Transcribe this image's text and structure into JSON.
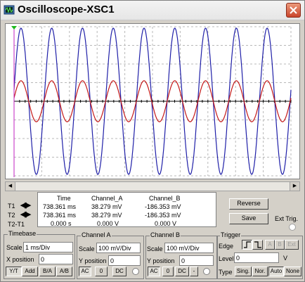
{
  "window": {
    "title": "Oscilloscope-XSC1"
  },
  "chart_data": {
    "type": "line",
    "title": "",
    "xlabel": "",
    "ylabel": "",
    "grid": true,
    "series": [
      {
        "color": "#1f1fa8",
        "description_role": "large amplitude sine",
        "amplitude": 1.0,
        "cycles": 9
      },
      {
        "color": "#c41818",
        "description_role": "small amplitude sine",
        "amplitude": 0.28,
        "cycles": 9
      }
    ],
    "colors": {
      "blue": "#1f1fa8",
      "red": "#c41818",
      "cursor": "#c020c0"
    }
  },
  "cursors": {
    "t1_label": "T1",
    "t2_label": "T2",
    "diff_label": "T2-T1",
    "arrows": "◀▶"
  },
  "readout": {
    "headers": {
      "time": "Time",
      "a": "Channel_A",
      "b": "Channel_B"
    },
    "rows": [
      {
        "time": "738.361 ms",
        "a": "38.279 mV",
        "b": "-186.353 mV"
      },
      {
        "time": "738.361 ms",
        "a": "38.279 mV",
        "b": "-186.353 mV"
      },
      {
        "time": "0.000 s",
        "a": "0.000 V",
        "b": "0.000 V"
      }
    ]
  },
  "buttons": {
    "reverse": "Reverse",
    "save": "Save",
    "ext_trig": "Ext Trig."
  },
  "timebase": {
    "label": "Timebase",
    "scale_label": "Scale",
    "scale_value": "1 ms/Div",
    "xpos_label": "X position",
    "xpos_value": "0",
    "modes": [
      "Y/T",
      "Add",
      "B/A",
      "A/B"
    ]
  },
  "channel_a": {
    "label": "Channel A",
    "scale_label": "Scale",
    "scale_value": "100 mV/Div",
    "ypos_label": "Y position",
    "ypos_value": "0",
    "coupling": [
      "AC",
      "0",
      "DC"
    ]
  },
  "channel_b": {
    "label": "Channel B",
    "scale_label": "Scale",
    "scale_value": "100 mV/Div",
    "ypos_label": "Y position",
    "ypos_value": "0",
    "coupling": [
      "AC",
      "0",
      "DC",
      "-"
    ]
  },
  "trigger": {
    "label": "Trigger",
    "edge_label": "Edge",
    "edge_sources": [
      "A",
      "B",
      "Ext"
    ],
    "level_label": "Level",
    "level_value": "0",
    "level_unit": "V",
    "type_label": "Type",
    "types": [
      "Sing.",
      "Nor.",
      "Auto",
      "None"
    ]
  }
}
